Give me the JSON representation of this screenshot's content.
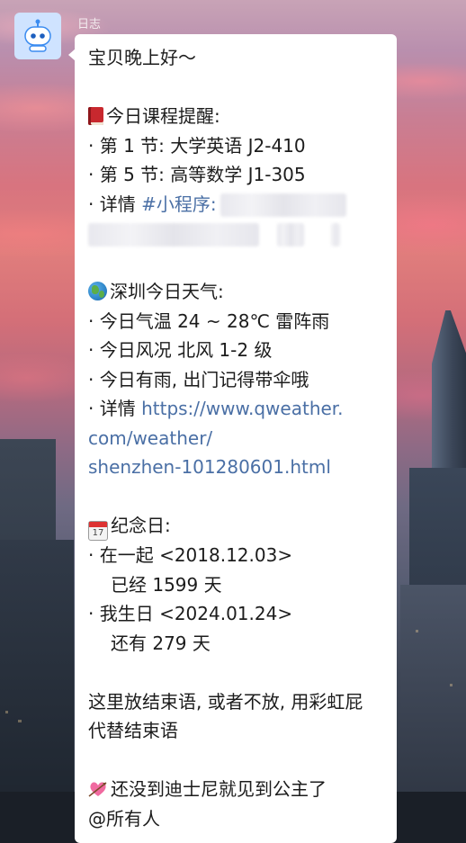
{
  "chat": {
    "sender_name": "日志",
    "avatar_icon": "robot-avatar-icon"
  },
  "message": {
    "greeting": "宝贝晚上好～",
    "course": {
      "heading": "今日课程提醒:",
      "heading_icon": "red-book-icon",
      "items": [
        "· 第 1 节: 大学英语 J2-410",
        "· 第 5 节: 高等数学 J1-305"
      ],
      "details_prefix": "· 详情 ",
      "details_link": "#小程序:"
    },
    "weather": {
      "heading": "深圳今日天气:",
      "heading_icon": "globe-icon",
      "items": [
        "· 今日气温 24 ~ 28℃  雷阵雨",
        "· 今日风况 北风 1-2 级",
        "· 今日有雨, 出门记得带伞哦"
      ],
      "details_prefix": "· 详情 ",
      "link_line1": "https://www.qweather.",
      "link_line2": "com/weather/",
      "link_line3": "shenzhen-101280601.html"
    },
    "anniversary": {
      "heading": "纪念日:",
      "heading_icon": "calendar-icon",
      "calendar_day": "17",
      "items": [
        {
          "line1": "· 在一起 <2018.12.03>",
          "line2": "已经 1599 天"
        },
        {
          "line1": "· 我生日 <2024.01.24>",
          "line2": "还有 279 天"
        }
      ]
    },
    "closing_line1": "这里放结束语, 或者不放, 用彩虹屁",
    "closing_line2": "代替结束语",
    "footer_icon": "heart-arrow-icon",
    "footer_line1": "还没到迪士尼就见到公主了",
    "footer_line2": "@所有人"
  }
}
